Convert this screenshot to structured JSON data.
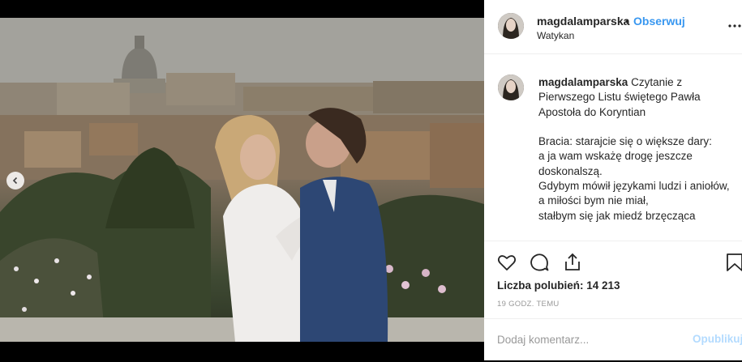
{
  "post": {
    "username": "magdalamparska",
    "separator": "•",
    "follow_label": "Obserwuj",
    "location": "Watykan",
    "caption_username": "magdalamparska",
    "caption_text": " Czytanie z Pierwszego Listu świętego Pawła Apostoła do Koryntian\n\nBracia: starajcie się o większe dary:\na ja wam wskażę drogę jeszcze doskonalszą.\nGdybym mówił językami ludzi i aniołów,\na miłości bym nie miał,\nstałbym się jak miedź brzęcząca",
    "likes_label": "Liczba polubień: 14 213",
    "time_ago": "19 GODZ. TEMU",
    "comment_placeholder": "Dodaj komentarz...",
    "publish_label": "Opublikuj"
  },
  "carousel": {
    "slide_count": 4,
    "active_index": 3
  },
  "icons": {
    "more": "more-options-icon",
    "like": "heart-icon",
    "comment": "comment-icon",
    "share": "share-icon",
    "save": "bookmark-icon",
    "prev": "chevron-left-icon"
  },
  "colors": {
    "link": "#3897f0",
    "text": "#262626",
    "muted": "#999999",
    "publish_disabled": "#b3dbff"
  }
}
